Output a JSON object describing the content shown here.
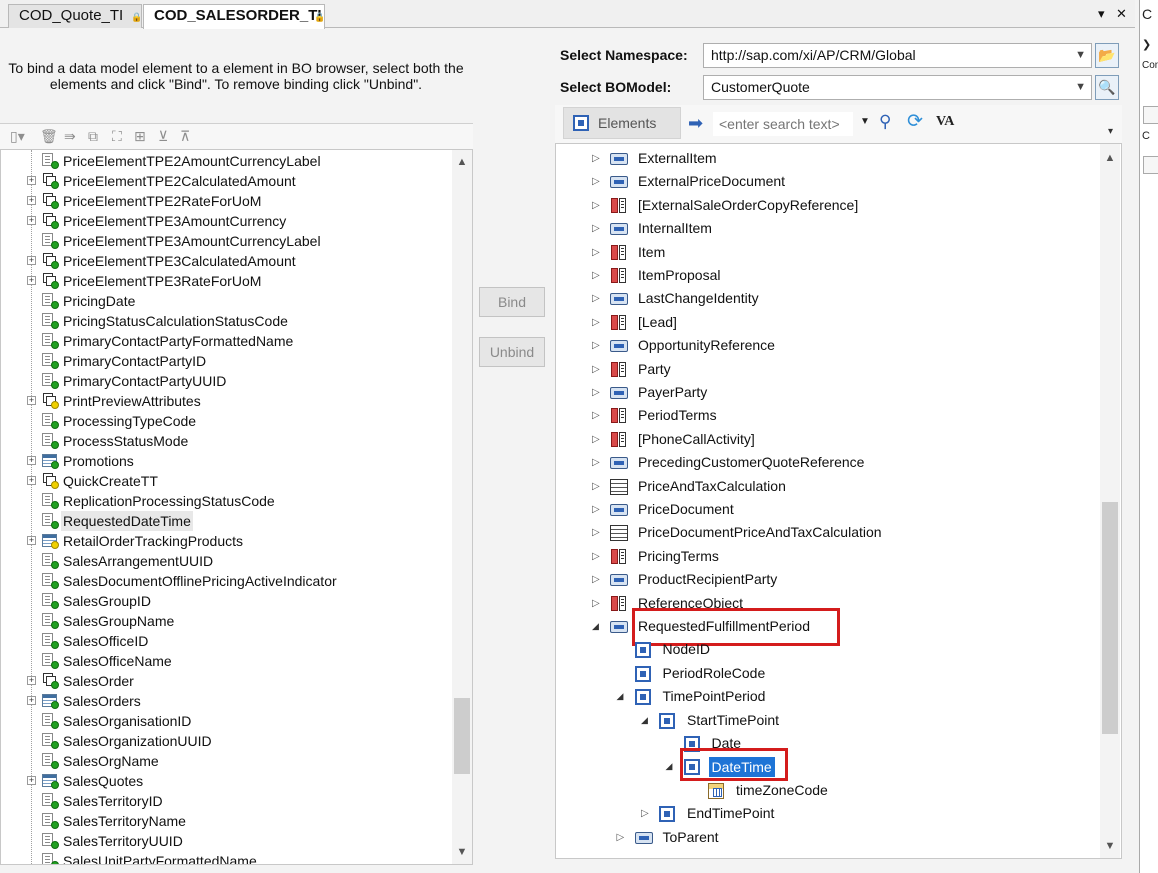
{
  "tabs": [
    {
      "label": "COD_Quote_TI",
      "active": false
    },
    {
      "label": "COD_SALESORDER_TI",
      "active": true
    }
  ],
  "instruction": "To bind a data model element to a element in BO browser, select both the elements and click \"Bind\". To remove binding click \"Unbind\".",
  "buttons": {
    "bind": "Bind",
    "unbind": "Unbind"
  },
  "namespace": {
    "label": "Select Namespace:",
    "value": "http://sap.com/xi/AP/CRM/Global"
  },
  "bomodel": {
    "label": "Select BOModel:",
    "value": "CustomerQuote"
  },
  "toolbar": {
    "elements_label": "Elements",
    "search_placeholder": "<enter search text>",
    "va_label": "VA"
  },
  "left_tree": [
    {
      "label": "PriceElementTPE2AmountCurrencyLabel",
      "type": "attr",
      "expandable": false
    },
    {
      "label": "PriceElementTPE2CalculatedAmount",
      "type": "struct",
      "expandable": true
    },
    {
      "label": "PriceElementTPE2RateForUoM",
      "type": "struct",
      "expandable": true
    },
    {
      "label": "PriceElementTPE3AmountCurrency",
      "type": "struct",
      "expandable": true
    },
    {
      "label": "PriceElementTPE3AmountCurrencyLabel",
      "type": "attr",
      "expandable": false
    },
    {
      "label": "PriceElementTPE3CalculatedAmount",
      "type": "struct",
      "expandable": true
    },
    {
      "label": "PriceElementTPE3RateForUoM",
      "type": "struct",
      "expandable": true
    },
    {
      "label": "PricingDate",
      "type": "attr",
      "expandable": false
    },
    {
      "label": "PricingStatusCalculationStatusCode",
      "type": "attr",
      "expandable": false
    },
    {
      "label": "PrimaryContactPartyFormattedName",
      "type": "attr",
      "expandable": false
    },
    {
      "label": "PrimaryContactPartyID",
      "type": "attr",
      "expandable": false
    },
    {
      "label": "PrimaryContactPartyUUID",
      "type": "attr",
      "expandable": false
    },
    {
      "label": "PrintPreviewAttributes",
      "type": "struct-yellow",
      "expandable": true
    },
    {
      "label": "ProcessingTypeCode",
      "type": "attr",
      "expandable": false
    },
    {
      "label": "ProcessStatusMode",
      "type": "attr",
      "expandable": false
    },
    {
      "label": "Promotions",
      "type": "table",
      "expandable": true
    },
    {
      "label": "QuickCreateTT",
      "type": "struct-yellow",
      "expandable": true
    },
    {
      "label": "ReplicationProcessingStatusCode",
      "type": "attr",
      "expandable": false
    },
    {
      "label": "RequestedDateTime",
      "type": "attr",
      "expandable": false,
      "highlight": true
    },
    {
      "label": "RetailOrderTrackingProducts",
      "type": "table-yellow",
      "expandable": true
    },
    {
      "label": "SalesArrangementUUID",
      "type": "attr",
      "expandable": false
    },
    {
      "label": "SalesDocumentOfflinePricingActiveIndicator",
      "type": "attr",
      "expandable": false
    },
    {
      "label": "SalesGroupID",
      "type": "attr",
      "expandable": false
    },
    {
      "label": "SalesGroupName",
      "type": "attr",
      "expandable": false
    },
    {
      "label": "SalesOfficeID",
      "type": "attr",
      "expandable": false
    },
    {
      "label": "SalesOfficeName",
      "type": "attr",
      "expandable": false
    },
    {
      "label": "SalesOrder",
      "type": "struct",
      "expandable": true
    },
    {
      "label": "SalesOrders",
      "type": "table",
      "expandable": true
    },
    {
      "label": "SalesOrganisationID",
      "type": "attr",
      "expandable": false
    },
    {
      "label": "SalesOrganizationUUID",
      "type": "attr",
      "expandable": false
    },
    {
      "label": "SalesOrgName",
      "type": "attr",
      "expandable": false
    },
    {
      "label": "SalesQuotes",
      "type": "table",
      "expandable": true
    },
    {
      "label": "SalesTerritoryID",
      "type": "attr",
      "expandable": false
    },
    {
      "label": "SalesTerritoryName",
      "type": "attr",
      "expandable": false
    },
    {
      "label": "SalesTerritoryUUID",
      "type": "attr",
      "expandable": false
    },
    {
      "label": "SalesUnitPartyFormattedName",
      "type": "attr",
      "expandable": false
    }
  ],
  "right_tree": [
    {
      "label": "ExternalItem",
      "icon": "node",
      "level": 0,
      "state": "collapsed"
    },
    {
      "label": "ExternalPriceDocument",
      "icon": "node",
      "level": 0,
      "state": "collapsed"
    },
    {
      "label": "[ExternalSaleOrderCopyReference]",
      "icon": "assoc",
      "level": 0,
      "state": "collapsed"
    },
    {
      "label": "InternalItem",
      "icon": "node",
      "level": 0,
      "state": "collapsed"
    },
    {
      "label": "Item",
      "icon": "assoc",
      "level": 0,
      "state": "collapsed"
    },
    {
      "label": "ItemProposal",
      "icon": "assoc",
      "level": 0,
      "state": "collapsed"
    },
    {
      "label": "LastChangeIdentity",
      "icon": "node",
      "level": 0,
      "state": "collapsed"
    },
    {
      "label": "[Lead]",
      "icon": "assoc",
      "level": 0,
      "state": "collapsed"
    },
    {
      "label": "OpportunityReference",
      "icon": "node",
      "level": 0,
      "state": "collapsed"
    },
    {
      "label": "Party",
      "icon": "assoc",
      "level": 0,
      "state": "collapsed"
    },
    {
      "label": "PayerParty",
      "icon": "node",
      "level": 0,
      "state": "collapsed"
    },
    {
      "label": "PeriodTerms",
      "icon": "assoc",
      "level": 0,
      "state": "collapsed"
    },
    {
      "label": "[PhoneCallActivity]",
      "icon": "assoc",
      "level": 0,
      "state": "collapsed"
    },
    {
      "label": "PrecedingCustomerQuoteReference",
      "icon": "node",
      "level": 0,
      "state": "collapsed"
    },
    {
      "label": "PriceAndTaxCalculation",
      "icon": "grid",
      "level": 0,
      "state": "collapsed"
    },
    {
      "label": "PriceDocument",
      "icon": "node",
      "level": 0,
      "state": "collapsed"
    },
    {
      "label": "PriceDocumentPriceAndTaxCalculation",
      "icon": "grid",
      "level": 0,
      "state": "collapsed"
    },
    {
      "label": "PricingTerms",
      "icon": "assoc",
      "level": 0,
      "state": "collapsed"
    },
    {
      "label": "ProductRecipientParty",
      "icon": "node",
      "level": 0,
      "state": "collapsed"
    },
    {
      "label": "ReferenceObject",
      "icon": "assoc",
      "level": 0,
      "state": "collapsed"
    },
    {
      "label": "RequestedFulfillmentPeriod",
      "icon": "node",
      "level": 0,
      "state": "expanded",
      "boxed": true
    },
    {
      "label": "NodeID",
      "icon": "elem",
      "level": 1,
      "state": "none"
    },
    {
      "label": "PeriodRoleCode",
      "icon": "elem",
      "level": 1,
      "state": "none"
    },
    {
      "label": "TimePointPeriod",
      "icon": "elem",
      "level": 1,
      "state": "expanded"
    },
    {
      "label": "StartTimePoint",
      "icon": "elem",
      "level": 2,
      "state": "expanded"
    },
    {
      "label": "Date",
      "icon": "elem",
      "level": 3,
      "state": "none"
    },
    {
      "label": "DateTime",
      "icon": "elem",
      "level": 3,
      "state": "expanded",
      "selected": true,
      "boxed": true
    },
    {
      "label": "timeZoneCode",
      "icon": "tz",
      "level": 4,
      "state": "none"
    },
    {
      "label": "EndTimePoint",
      "icon": "elem",
      "level": 2,
      "state": "collapsed"
    },
    {
      "label": "ToParent",
      "icon": "node",
      "level": 1,
      "state": "collapsed"
    }
  ],
  "edge_fragments": [
    "C",
    "Con",
    "C",
    "C"
  ],
  "colors": {
    "selection": "#1e74d6",
    "highlight_box": "#d41c1c",
    "status_dot": "#21a021"
  }
}
